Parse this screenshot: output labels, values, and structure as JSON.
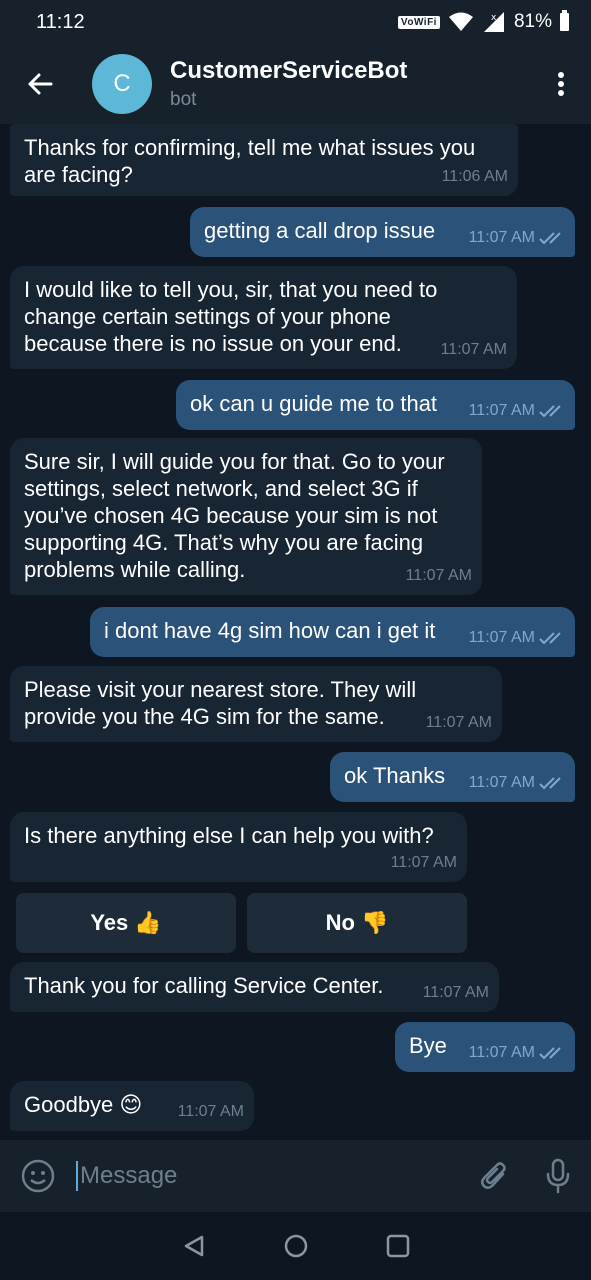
{
  "status_bar": {
    "time": "11:12",
    "wifi_label": "VoWiFi",
    "battery": "81%"
  },
  "header": {
    "avatar_letter": "C",
    "title": "CustomerServiceBot",
    "subtitle": "bot"
  },
  "messages": [
    {
      "dir": "in",
      "text": "Thanks for confirming, tell me what issues you are facing?",
      "time": "11:06 AM"
    },
    {
      "dir": "out",
      "text": "getting a call drop issue",
      "time": "11:07 AM"
    },
    {
      "dir": "in",
      "text": "I would like to tell you, sir, that you need to change certain settings of your phone because there is no issue on your end.",
      "time": "11:07 AM"
    },
    {
      "dir": "out",
      "text": "ok can u guide me to that",
      "time": "11:07 AM"
    },
    {
      "dir": "in",
      "text": "Sure sir, I will guide you for that. Go to your settings, select network, and select 3G if you’ve chosen 4G because your sim is not supporting 4G. That’s why you are facing problems while calling.",
      "time": "11:07 AM"
    },
    {
      "dir": "out",
      "text": "i dont have 4g sim how can i get it",
      "time": "11:07 AM"
    },
    {
      "dir": "in",
      "text": "Please visit your nearest store. They will provide you the 4G sim for the same.",
      "time": "11:07 AM"
    },
    {
      "dir": "out",
      "text": "ok Thanks",
      "time": "11:07 AM"
    },
    {
      "dir": "in",
      "text": "Is there anything else I can help you with?",
      "time": "11:07 AM"
    },
    {
      "dir": "in",
      "text": "Thank you for calling Service Center.",
      "time": "11:07 AM"
    },
    {
      "dir": "out",
      "text": "Bye",
      "time": "11:07 AM"
    },
    {
      "dir": "in",
      "text": "Goodbye 😊",
      "time": "11:07 AM"
    }
  ],
  "keyboard": {
    "yes_label": "Yes",
    "yes_emoji": "👍",
    "no_label": "No",
    "no_emoji": "👎"
  },
  "input": {
    "placeholder": "Message"
  },
  "colors": {
    "background": "#0e1621",
    "header": "#17212b",
    "incoming": "#182533",
    "outgoing": "#2b5278",
    "avatar": "#5cb8d6",
    "read_check": "#7fa9d1"
  }
}
